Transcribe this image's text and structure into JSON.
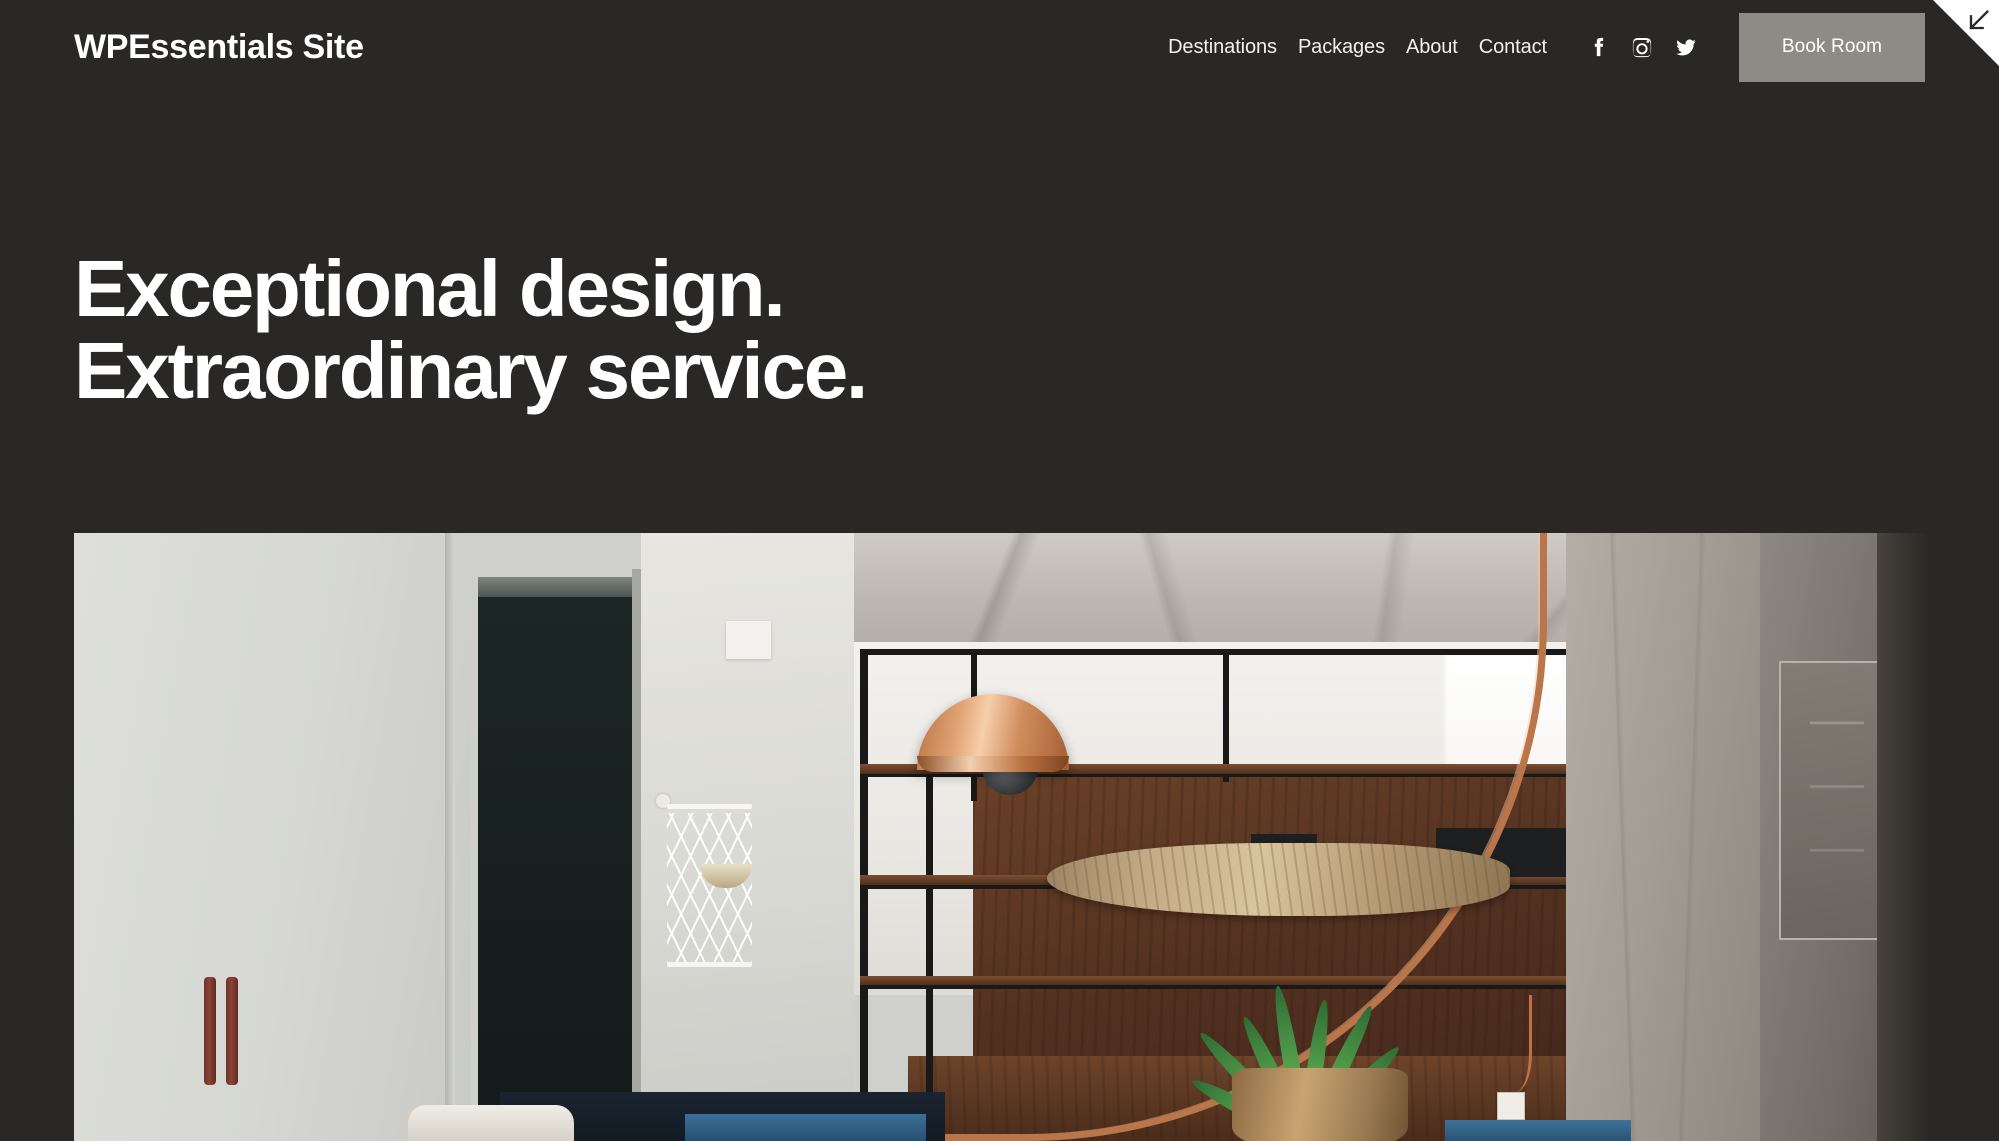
{
  "site": {
    "title": "WPEssentials Site",
    "background_color": "#292827",
    "text_color": "#ffffff",
    "accent_color": "#8d8b84"
  },
  "header": {
    "nav": [
      {
        "label": "Destinations",
        "name": "nav-link-destinations"
      },
      {
        "label": "Packages",
        "name": "nav-link-packages"
      },
      {
        "label": "About",
        "name": "nav-link-about"
      },
      {
        "label": "Contact",
        "name": "nav-link-contact"
      }
    ],
    "social": [
      {
        "icon": "facebook-icon",
        "label": "Facebook"
      },
      {
        "icon": "instagram-icon",
        "label": "Instagram"
      },
      {
        "icon": "twitter-icon",
        "label": "Twitter"
      }
    ],
    "cta": {
      "label": "Book Room",
      "background_color": "#8d8b84"
    },
    "corner": {
      "icon": "arrow-down-left-icon",
      "background_color": "#ffffff"
    }
  },
  "hero": {
    "headline_line1": "Exceptional design.",
    "headline_line2": "Extraordinary service.",
    "image_alt": "Modern loft interior with copper arc lamp, black steel and walnut shelving, concrete ceiling and staghorn fern"
  }
}
